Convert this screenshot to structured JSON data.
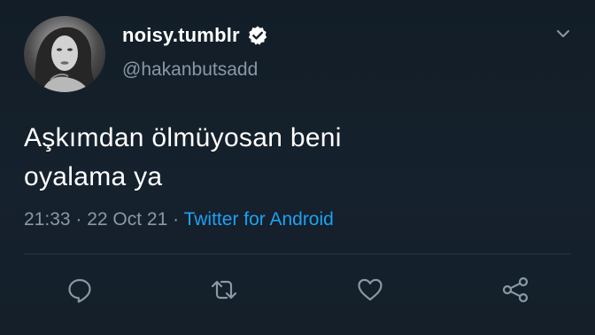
{
  "tweet": {
    "display_name": "noisy.tumblr",
    "handle": "@hakanbutsadd",
    "text_line1": "Aşkımdan ölmüyosan beni",
    "text_line2": "oyalama ya",
    "time": "21:33",
    "date": "22 Oct 21",
    "separator": "·",
    "source": "Twitter for Android"
  },
  "icons": {
    "verified": "verified-badge-icon",
    "more": "chevron-down-icon",
    "reply": "reply-icon",
    "retweet": "retweet-icon",
    "like": "heart-icon",
    "share": "share-icon"
  },
  "colors": {
    "background": "#15202b",
    "text": "#ffffff",
    "muted": "#8899a6",
    "link": "#1da1f2"
  }
}
